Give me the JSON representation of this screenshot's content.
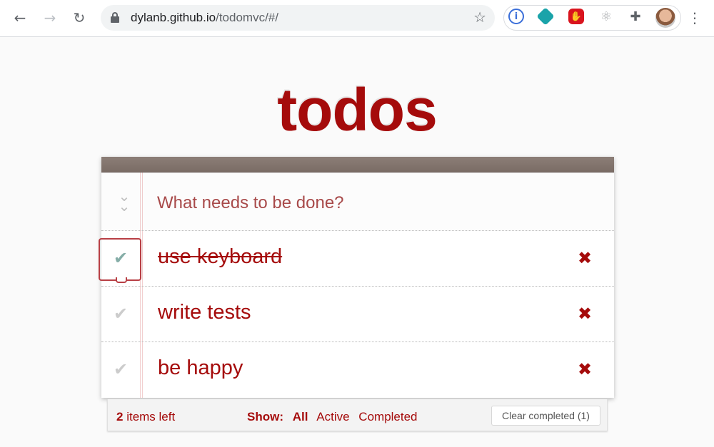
{
  "browser": {
    "url_host": "dylanb.github.io",
    "url_path": "/todomvc/#/",
    "back_icon": "arrow-left",
    "forward_icon": "arrow-right",
    "reload_icon": "reload",
    "star_icon": "star",
    "menu_icon": "more-vertical"
  },
  "app": {
    "title": "todos",
    "new_todo_placeholder": "What needs to be done?",
    "toggle_all_icon": "double-chevron-down",
    "items": [
      {
        "label": "use keyboard",
        "completed": true,
        "focused": true
      },
      {
        "label": "write tests",
        "completed": false
      },
      {
        "label": "be happy",
        "completed": false
      }
    ],
    "footer": {
      "count": "2",
      "count_suffix": " items left",
      "show_label": "Show:",
      "filters": [
        "All",
        "Active",
        "Completed"
      ],
      "selected_filter": "All",
      "clear_completed": "Clear completed (1)"
    }
  },
  "colors": {
    "accent": "#a50b0b",
    "topbar": "#7f716b",
    "check_done": "#85ada7",
    "check_undone": "#cccccc"
  }
}
